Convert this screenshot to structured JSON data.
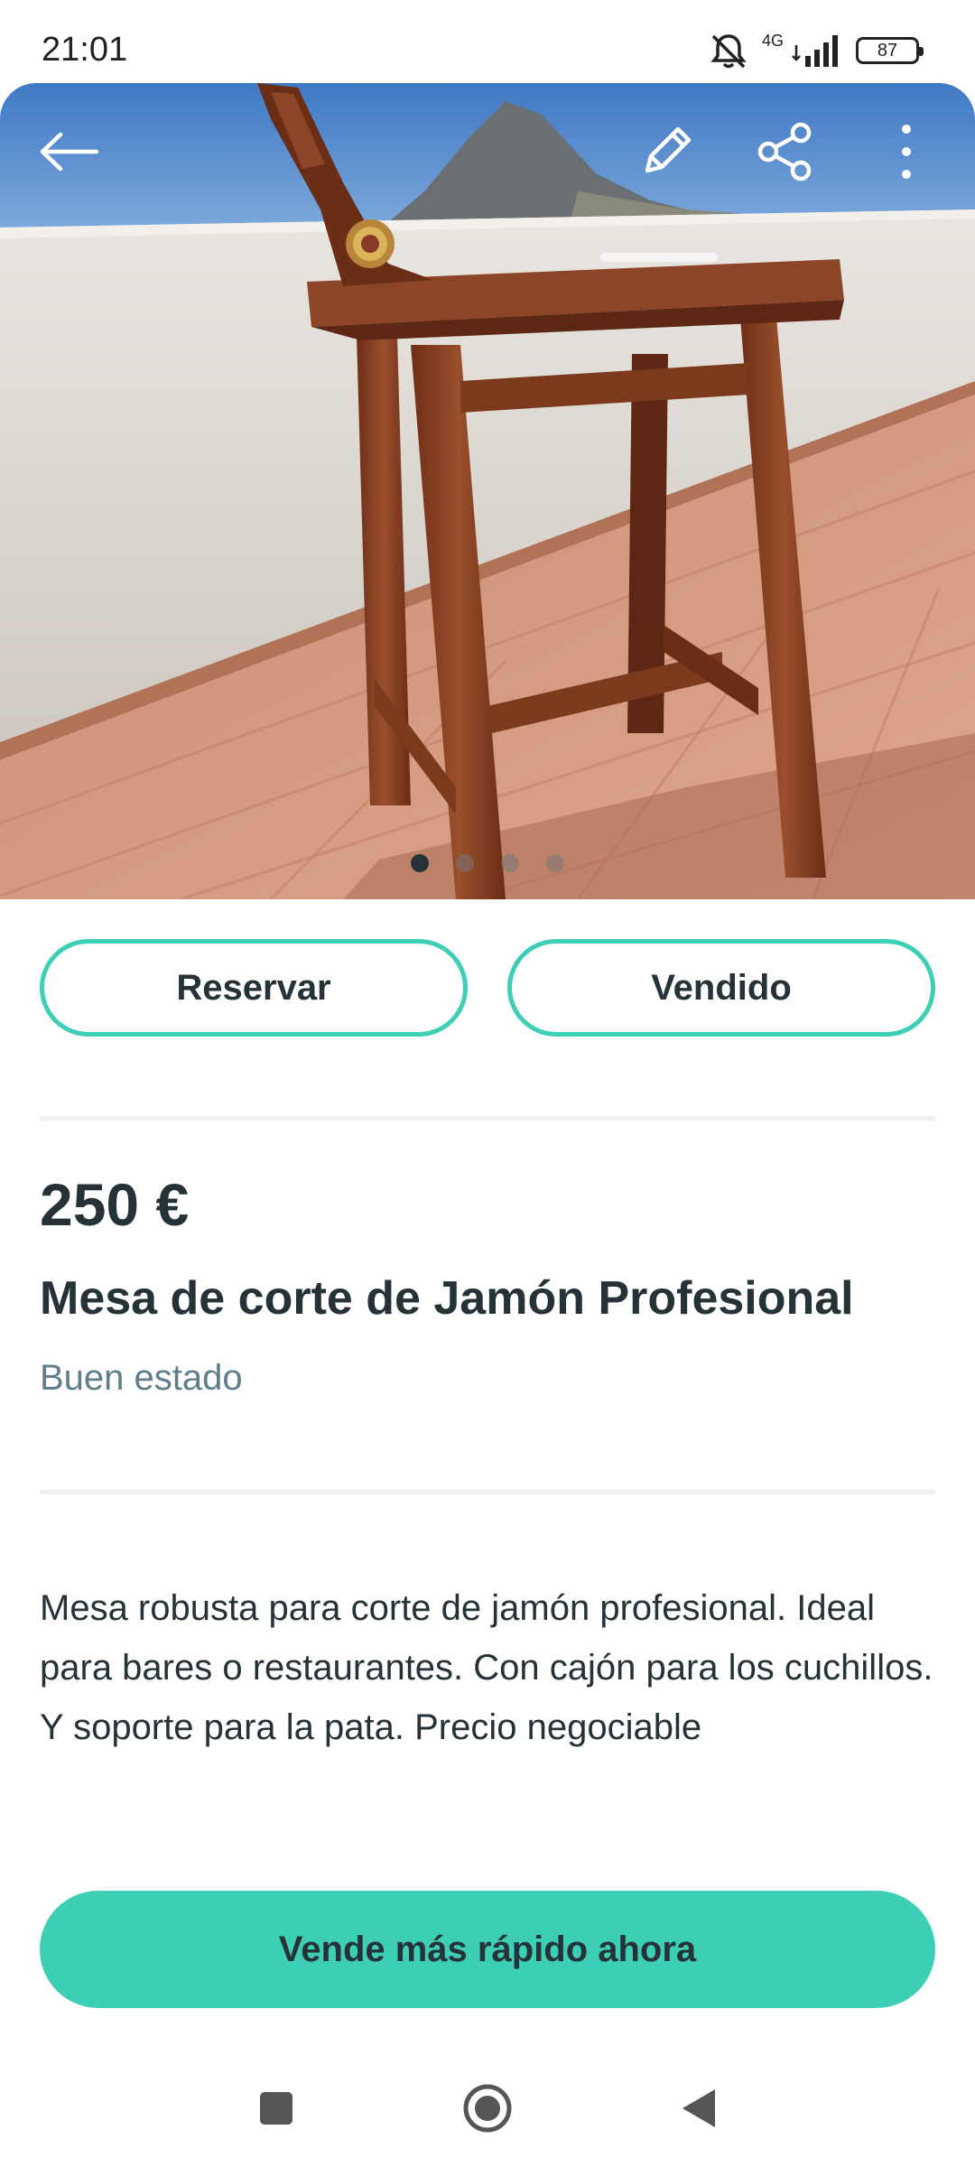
{
  "status_bar": {
    "time": "21:01",
    "network": "4G",
    "battery": "87"
  },
  "hero": {
    "image_description": "wooden ham cutting stand on terrace",
    "icons": [
      "back-arrow-icon",
      "pencil-icon",
      "share-icon",
      "more-vertical-icon"
    ],
    "dots": 4,
    "active_dot": 0
  },
  "actions": {
    "reserve_label": "Reservar",
    "sold_label": "Vendido"
  },
  "listing": {
    "price": "250 €",
    "title": "Mesa de corte de Jamón Profesional",
    "condition": "Buen estado",
    "description": "Mesa robusta para corte de jamón profesional. Ideal para bares o restaurantes. Con cajón para los cuchillos. Y soporte para la pata. Precio negociable"
  },
  "cta": {
    "label": "Vende más rápido ahora"
  },
  "colors": {
    "accent": "#3dcfb5",
    "text": "#253238",
    "muted": "#607d8b"
  }
}
